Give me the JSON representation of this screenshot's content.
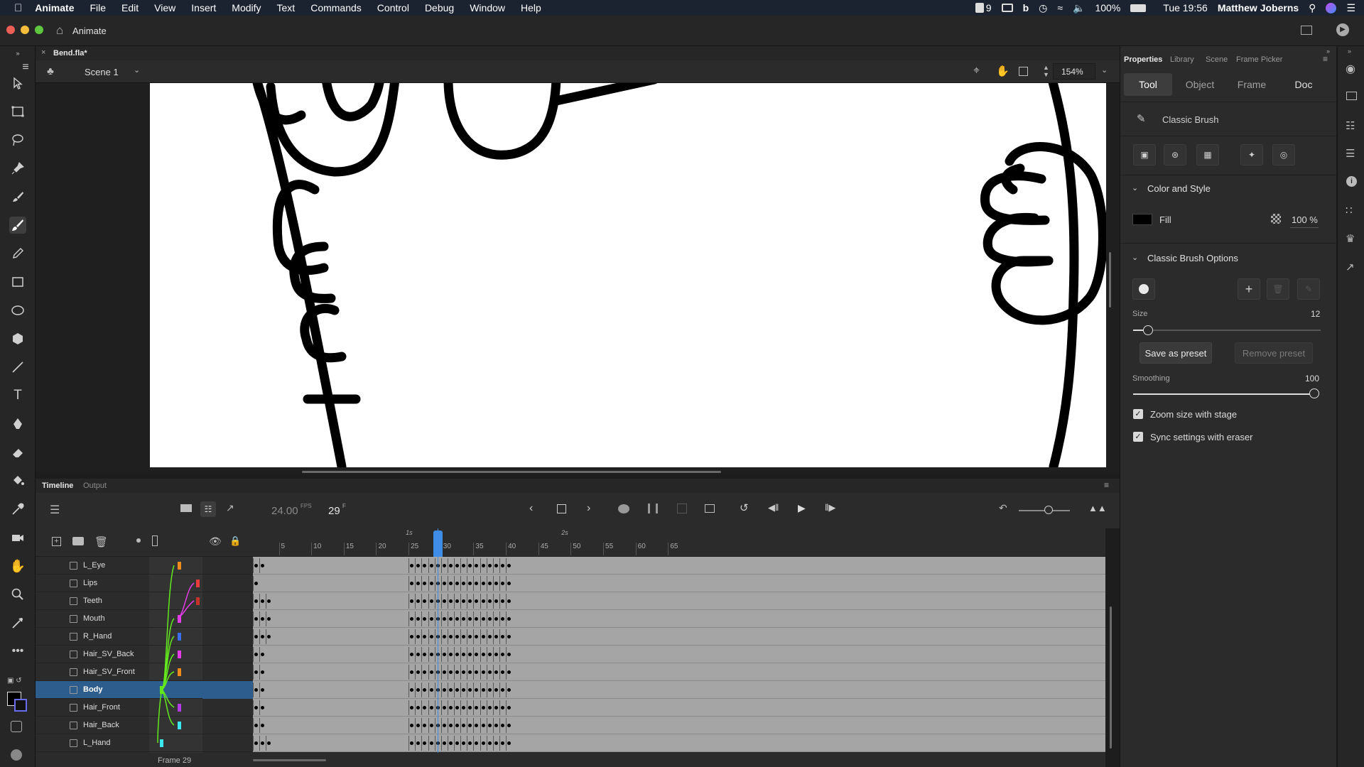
{
  "menubar": {
    "apple": "",
    "app": "Animate",
    "items": [
      "File",
      "Edit",
      "View",
      "Insert",
      "Modify",
      "Text",
      "Commands",
      "Control",
      "Debug",
      "Window",
      "Help"
    ],
    "status": {
      "notif": "9",
      "battery": "100%",
      "clock": "Tue 19:56",
      "user": "Matthew Joberns"
    }
  },
  "titlebar": {
    "title": "Animate"
  },
  "document": {
    "tab": "Bend.fla*",
    "scene": "Scene 1",
    "zoom": "154%"
  },
  "timeline": {
    "tabs": [
      "Timeline",
      "Output"
    ],
    "fps": "24.00",
    "fps_unit": "FPS",
    "frame": "29",
    "frame_unit": "F",
    "footer": "Frame 29",
    "sec_marks": [
      "1s",
      "2s"
    ],
    "ruler": [
      "5",
      "10",
      "15",
      "20",
      "25",
      "30",
      "35",
      "40",
      "45",
      "50",
      "55",
      "60",
      "65"
    ],
    "playhead_frame": 29,
    "layers": [
      {
        "name": "L_Eye",
        "color": "#f08c1e"
      },
      {
        "name": "Lips",
        "color": "#e83c3c"
      },
      {
        "name": "Teeth",
        "color": "#c4322a"
      },
      {
        "name": "Mouth",
        "color": "#e43ce8"
      },
      {
        "name": "R_Hand",
        "color": "#3c6cf0"
      },
      {
        "name": "Hair_SV_Back",
        "color": "#e43ce8"
      },
      {
        "name": "Hair_SV_Front",
        "color": "#f08c1e"
      },
      {
        "name": "Body",
        "color": "#62e81c",
        "selected": true
      },
      {
        "name": "Hair_Front",
        "color": "#b43ce8"
      },
      {
        "name": "Hair_Back",
        "color": "#3ce8f0"
      },
      {
        "name": "L_Hand",
        "color": "#3ce8f0"
      }
    ]
  },
  "properties": {
    "tabs": [
      "Properties",
      "Library",
      "Scene",
      "Frame Picker"
    ],
    "segments": [
      "Tool",
      "Object",
      "Frame",
      "Doc"
    ],
    "tool_name": "Classic Brush",
    "color_section": "Color and Style",
    "fill_label": "Fill",
    "fill_alpha": "100 %",
    "brush_section": "Classic Brush Options",
    "size_label": "Size",
    "size_value": "12",
    "save_preset": "Save as preset",
    "remove_preset": "Remove preset",
    "smoothing_label": "Smoothing",
    "smoothing_value": "100",
    "zoom_with_stage": "Zoom size with stage",
    "sync_eraser": "Sync settings with eraser"
  }
}
